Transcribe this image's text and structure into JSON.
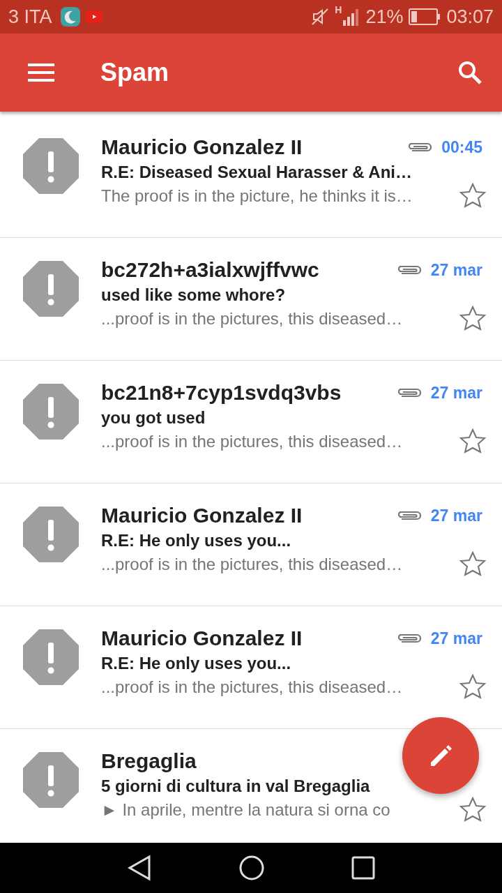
{
  "status_bar": {
    "carrier": "3 ITA",
    "network": "H",
    "battery": "21%",
    "time": "03:07"
  },
  "app_bar": {
    "title": "Spam"
  },
  "messages": [
    {
      "sender": "Mauricio Gonzalez II",
      "subject": "R.E: Diseased Sexual Harasser & Ani…",
      "preview": "The proof is in the picture, he thinks it is…",
      "date": "00:45",
      "attachment": true,
      "starred": false
    },
    {
      "sender": "bc272h+a3ialxwjffvwc",
      "subject": "used like some whore?",
      "preview": "...proof is in the pictures, this diseased…",
      "date": "27 mar",
      "attachment": true,
      "starred": false
    },
    {
      "sender": "bc21n8+7cyp1svdq3vbs",
      "subject": "you got used",
      "preview": "...proof is in the pictures, this diseased…",
      "date": "27 mar",
      "attachment": true,
      "starred": false
    },
    {
      "sender": "Mauricio Gonzalez II",
      "subject": "R.E: He only uses you...",
      "preview": "...proof is in the pictures, this diseased…",
      "date": "27 mar",
      "attachment": true,
      "starred": false
    },
    {
      "sender": "Mauricio Gonzalez II",
      "subject": "R.E: He only uses you...",
      "preview": "...proof is in the pictures, this diseased…",
      "date": "27 mar",
      "attachment": true,
      "starred": false
    },
    {
      "sender": "Bregaglia",
      "subject": "5 giorni di cultura in val Bregaglia",
      "preview": "► In aprile, mentre la natura si orna co",
      "starred": false
    }
  ]
}
